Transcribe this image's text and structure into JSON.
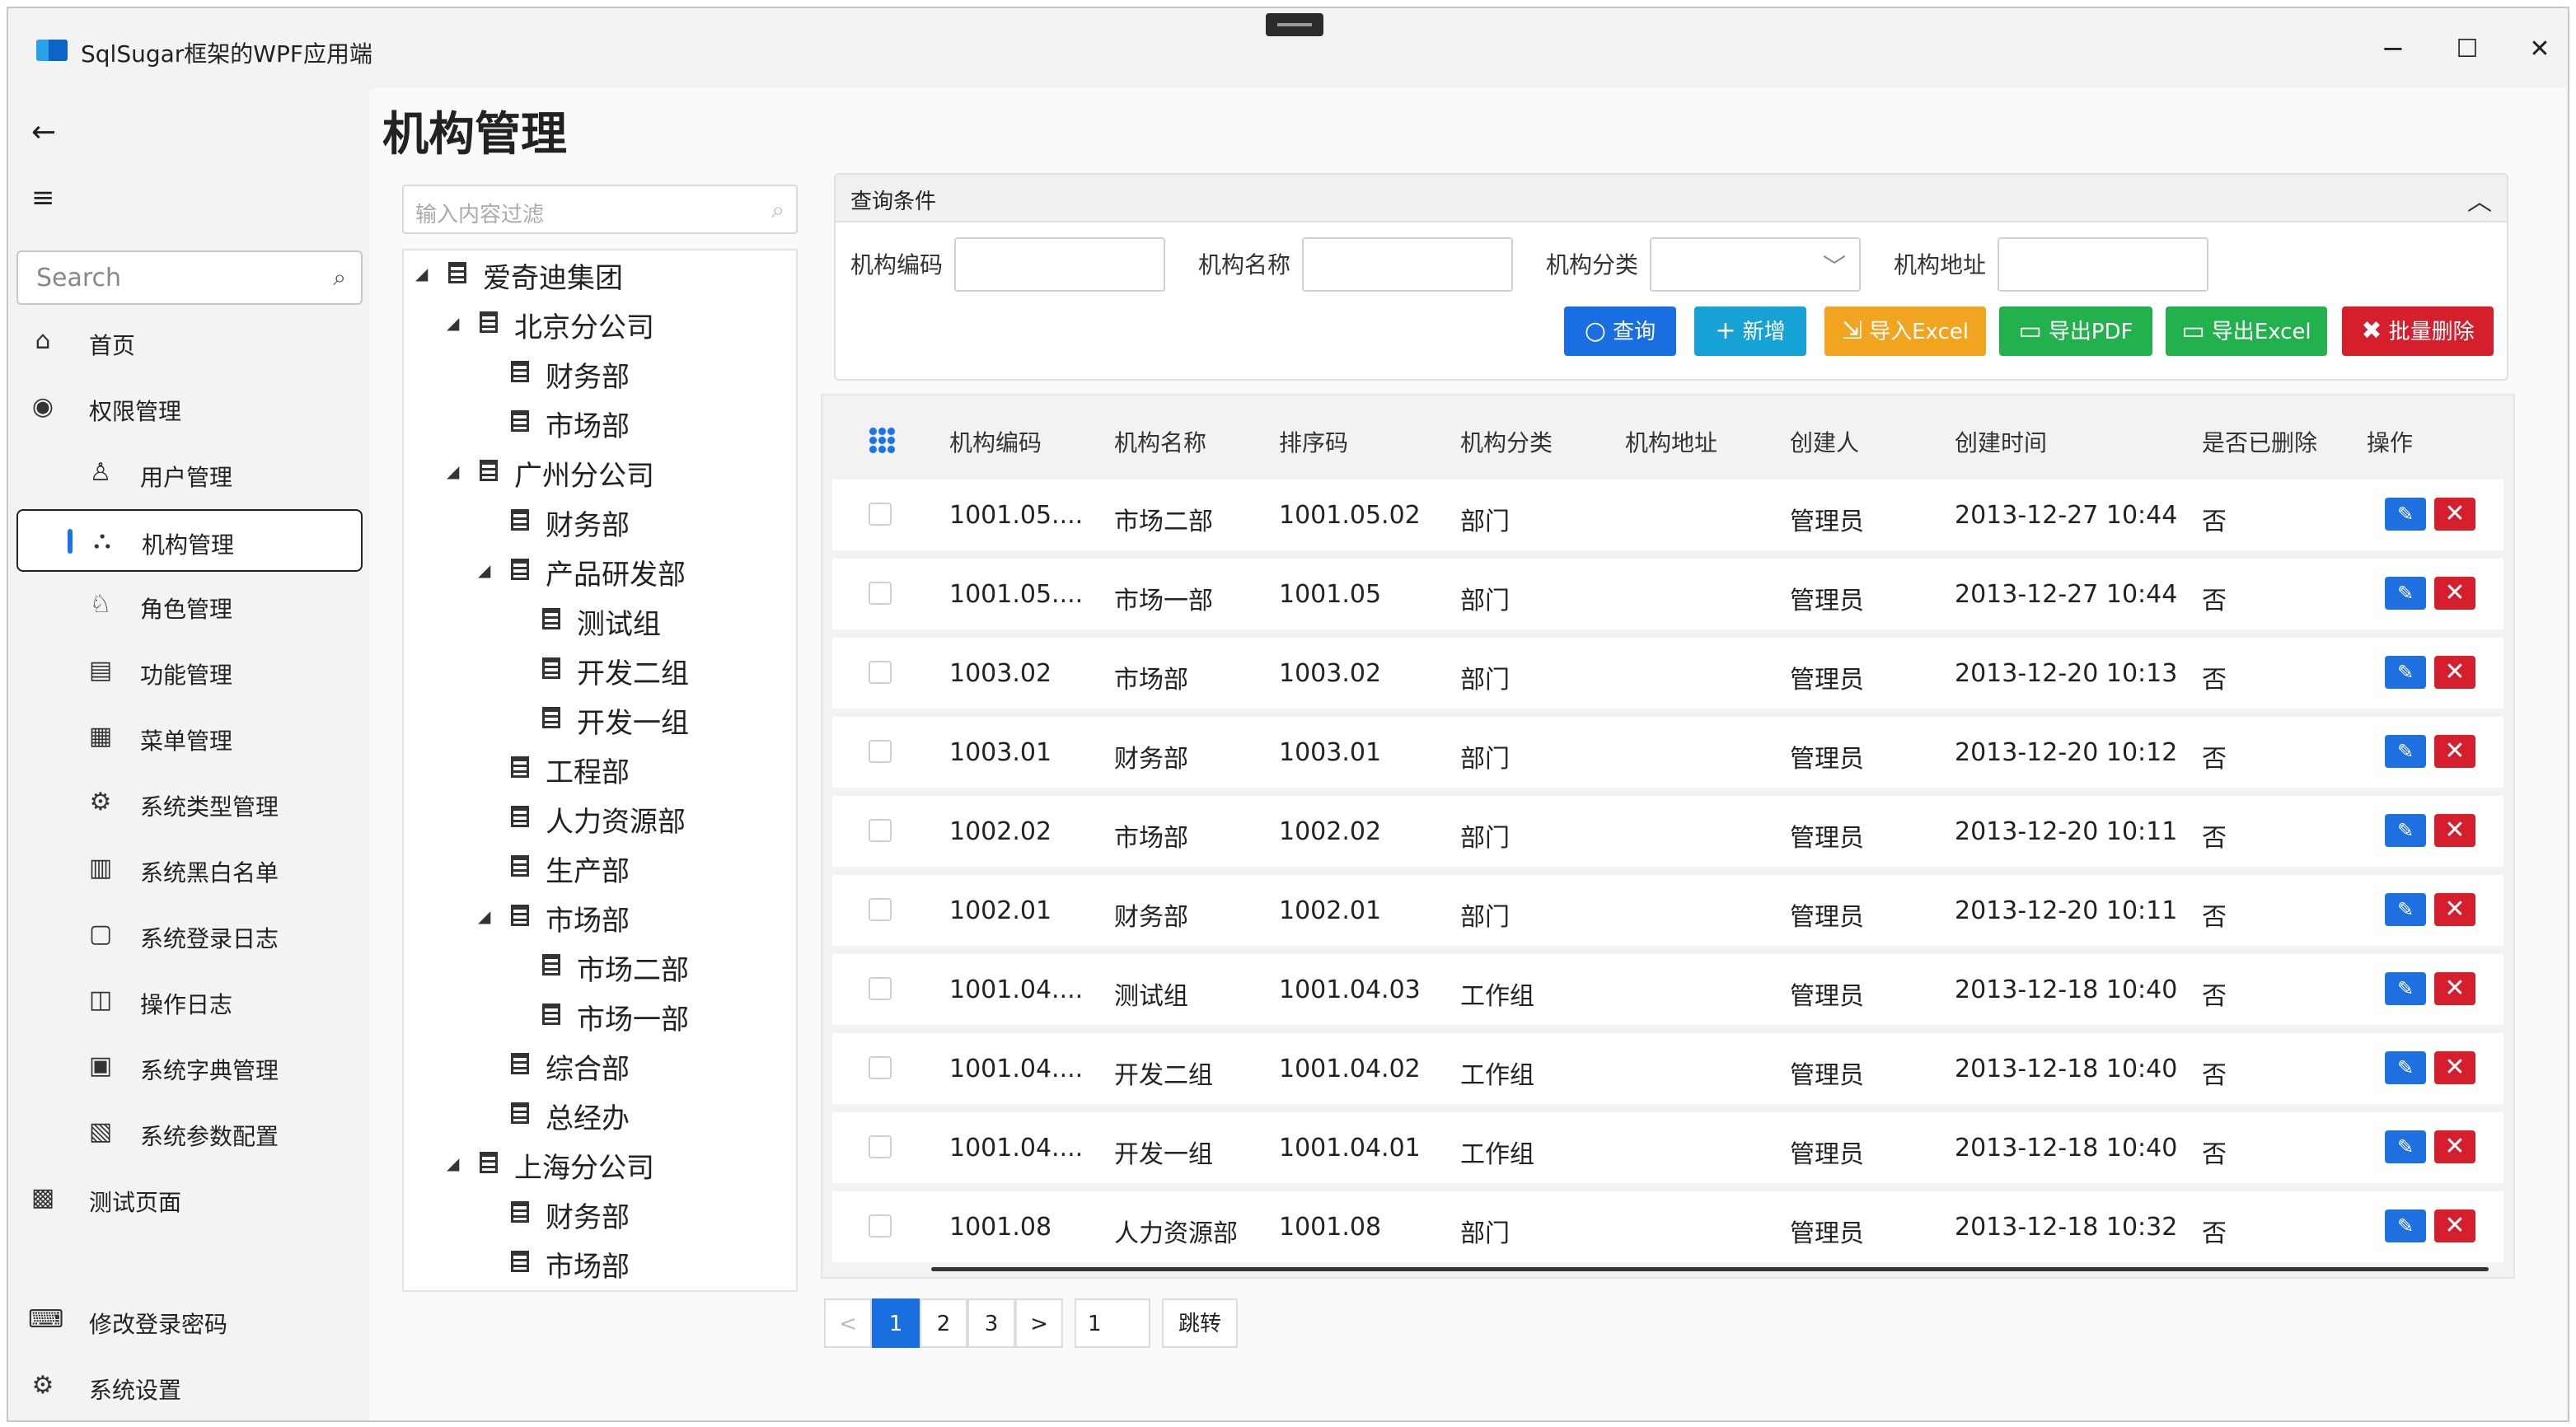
{
  "window": {
    "title": "SqlSugar框架的WPF应用端",
    "minimize": "─",
    "maximize": "☐",
    "close": "✕"
  },
  "nav": {
    "back": "←",
    "menu": "≡",
    "search_placeholder": "Search",
    "items": [
      {
        "label": "首页",
        "icon": "⌂"
      },
      {
        "label": "权限管理",
        "icon": "◉"
      },
      {
        "label": "用户管理",
        "icon": "♙"
      },
      {
        "label": "机构管理",
        "icon": "⛬"
      },
      {
        "label": "角色管理",
        "icon": "♘"
      },
      {
        "label": "功能管理",
        "icon": "▤"
      },
      {
        "label": "菜单管理",
        "icon": "▦"
      },
      {
        "label": "系统类型管理",
        "icon": "⚙"
      },
      {
        "label": "系统黑白名单",
        "icon": "▥"
      },
      {
        "label": "系统登录日志",
        "icon": "▢"
      },
      {
        "label": "操作日志",
        "icon": "◫"
      },
      {
        "label": "系统字典管理",
        "icon": "▣"
      },
      {
        "label": "系统参数配置",
        "icon": "▧"
      },
      {
        "label": "测试页面",
        "icon": "▩"
      }
    ],
    "footer": [
      {
        "label": "修改登录密码",
        "icon": "⌨"
      },
      {
        "label": "系统设置",
        "icon": "⚙"
      }
    ]
  },
  "page": {
    "title": "机构管理"
  },
  "tree": {
    "filter_placeholder": "输入内容过滤",
    "nodes": [
      {
        "label": "爱奇迪集团",
        "level": 0,
        "expanded": true
      },
      {
        "label": "北京分公司",
        "level": 1,
        "expanded": true
      },
      {
        "label": "财务部",
        "level": 2
      },
      {
        "label": "市场部",
        "level": 2
      },
      {
        "label": "广州分公司",
        "level": 1,
        "expanded": true
      },
      {
        "label": "财务部",
        "level": 2
      },
      {
        "label": "产品研发部",
        "level": 2,
        "expanded": true
      },
      {
        "label": "测试组",
        "level": 3
      },
      {
        "label": "开发二组",
        "level": 3
      },
      {
        "label": "开发一组",
        "level": 3
      },
      {
        "label": "工程部",
        "level": 2
      },
      {
        "label": "人力资源部",
        "level": 2
      },
      {
        "label": "生产部",
        "level": 2
      },
      {
        "label": "市场部",
        "level": 2,
        "expanded": true
      },
      {
        "label": "市场二部",
        "level": 3
      },
      {
        "label": "市场一部",
        "level": 3
      },
      {
        "label": "综合部",
        "level": 2
      },
      {
        "label": "总经办",
        "level": 2
      },
      {
        "label": "上海分公司",
        "level": 1,
        "expanded": true
      },
      {
        "label": "财务部",
        "level": 2
      },
      {
        "label": "市场部",
        "level": 2
      }
    ]
  },
  "query": {
    "title": "查询条件",
    "fields": [
      "机构编码",
      "机构名称",
      "机构分类",
      "机构地址"
    ],
    "buttons": [
      {
        "label": "查询",
        "icon": "○",
        "color": "#1a6fe0"
      },
      {
        "label": "新增",
        "icon": "+",
        "color": "#17a2d6"
      },
      {
        "label": "导入Excel",
        "icon": "⇲",
        "color": "#f0a420"
      },
      {
        "label": "导出PDF",
        "icon": "▭",
        "color": "#22b14c"
      },
      {
        "label": "导出Excel",
        "icon": "▭",
        "color": "#22b14c"
      },
      {
        "label": "批量删除",
        "icon": "✖",
        "color": "#d61f2c"
      }
    ]
  },
  "grid": {
    "columns": [
      "机构编码",
      "机构名称",
      "排序码",
      "机构分类",
      "机构地址",
      "创建人",
      "创建时间",
      "是否已删除",
      "操作"
    ],
    "rows": [
      [
        "1001.05....",
        "市场二部",
        "1001.05.02",
        "部门",
        "",
        "管理员",
        "2013-12-27 10:44",
        "否"
      ],
      [
        "1001.05....",
        "市场一部",
        "1001.05",
        "部门",
        "",
        "管理员",
        "2013-12-27 10:44",
        "否"
      ],
      [
        "1003.02",
        "市场部",
        "1003.02",
        "部门",
        "",
        "管理员",
        "2013-12-20 10:13",
        "否"
      ],
      [
        "1003.01",
        "财务部",
        "1003.01",
        "部门",
        "",
        "管理员",
        "2013-12-20 10:12",
        "否"
      ],
      [
        "1002.02",
        "市场部",
        "1002.02",
        "部门",
        "",
        "管理员",
        "2013-12-20 10:11",
        "否"
      ],
      [
        "1002.01",
        "财务部",
        "1002.01",
        "部门",
        "",
        "管理员",
        "2013-12-20 10:11",
        "否"
      ],
      [
        "1001.04....",
        "测试组",
        "1001.04.03",
        "工作组",
        "",
        "管理员",
        "2013-12-18 10:40",
        "否"
      ],
      [
        "1001.04....",
        "开发二组",
        "1001.04.02",
        "工作组",
        "",
        "管理员",
        "2013-12-18 10:40",
        "否"
      ],
      [
        "1001.04....",
        "开发一组",
        "1001.04.01",
        "工作组",
        "",
        "管理员",
        "2013-12-18 10:40",
        "否"
      ],
      [
        "1001.08",
        "人力资源部",
        "1001.08",
        "部门",
        "",
        "管理员",
        "2013-12-18 10:32",
        "否"
      ]
    ],
    "edit_icon": "✎",
    "delete_icon": "✕"
  },
  "pager": {
    "prev": "<",
    "pages": [
      "1",
      "2",
      "3"
    ],
    "next": ">",
    "jump_value": "1",
    "jump_label": "跳转"
  }
}
